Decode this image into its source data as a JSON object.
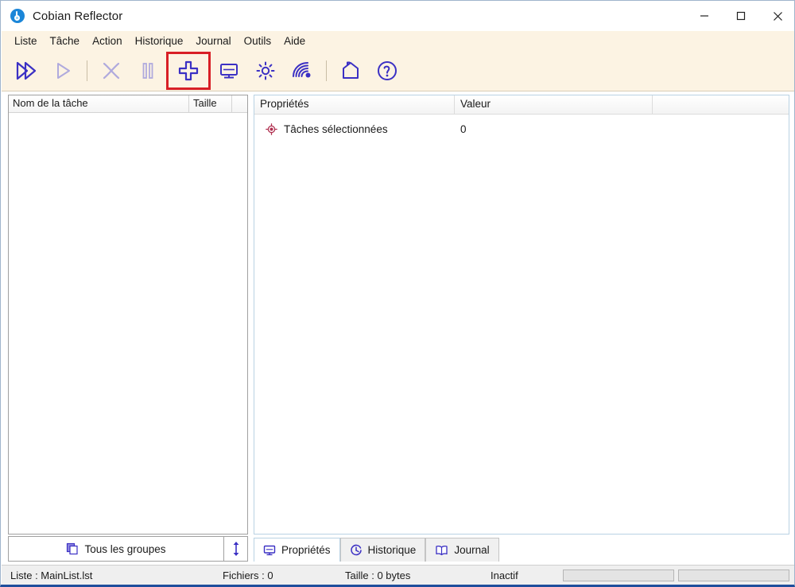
{
  "window": {
    "title": "Cobian Reflector",
    "icon": "app-icon",
    "controls": {
      "minimize": "minimize-icon",
      "maximize": "maximize-icon",
      "close": "close-icon"
    }
  },
  "menubar": {
    "items": [
      {
        "label": "Liste"
      },
      {
        "label": "Tâche"
      },
      {
        "label": "Action"
      },
      {
        "label": "Historique"
      },
      {
        "label": "Journal"
      },
      {
        "label": "Outils"
      },
      {
        "label": "Aide"
      }
    ]
  },
  "toolbar": {
    "highlight_color": "#d81f26",
    "icon_color": "#3b30c4",
    "buttons": [
      {
        "icon": "run-all-icon",
        "enabled": true
      },
      {
        "icon": "run-selected-icon",
        "enabled": false
      },
      {
        "separator_after": true
      },
      {
        "icon": "cancel-icon",
        "enabled": false
      },
      {
        "icon": "pause-icon",
        "enabled": false
      },
      {
        "icon": "new-task-icon",
        "enabled": true,
        "highlighted": true
      },
      {
        "icon": "monitor-icon",
        "enabled": true
      },
      {
        "icon": "settings-gear-icon",
        "enabled": true
      },
      {
        "icon": "remote-signal-icon",
        "enabled": true
      },
      {
        "separator_after": true
      },
      {
        "icon": "home-icon",
        "enabled": true
      },
      {
        "icon": "help-question-icon",
        "enabled": true
      }
    ]
  },
  "task_list": {
    "columns": [
      {
        "label": "Nom de la tâche"
      },
      {
        "label": "Taille"
      },
      {
        "label": ""
      }
    ],
    "rows": []
  },
  "group_bar": {
    "button_label": "Tous les groupes",
    "button_icon": "copy-stack-icon",
    "splitter_icon": "vertical-resize-icon"
  },
  "properties_panel": {
    "columns": [
      {
        "label": "Propriétés"
      },
      {
        "label": "Valeur"
      },
      {
        "label": ""
      }
    ],
    "rows": [
      {
        "icon": "target-bullet-icon",
        "label": "Tâches sélectionnées",
        "value": "0"
      }
    ]
  },
  "tabs": [
    {
      "label": "Propriétés",
      "icon": "monitor-icon",
      "active": true
    },
    {
      "label": "Historique",
      "icon": "clock-icon",
      "active": false
    },
    {
      "label": "Journal",
      "icon": "book-icon",
      "active": false
    }
  ],
  "statusbar": {
    "list": "Liste : MainList.lst",
    "files": "Fichiers : 0",
    "size": "Taille : 0 bytes",
    "state": "Inactif",
    "progress_1": "",
    "progress_2": ""
  }
}
